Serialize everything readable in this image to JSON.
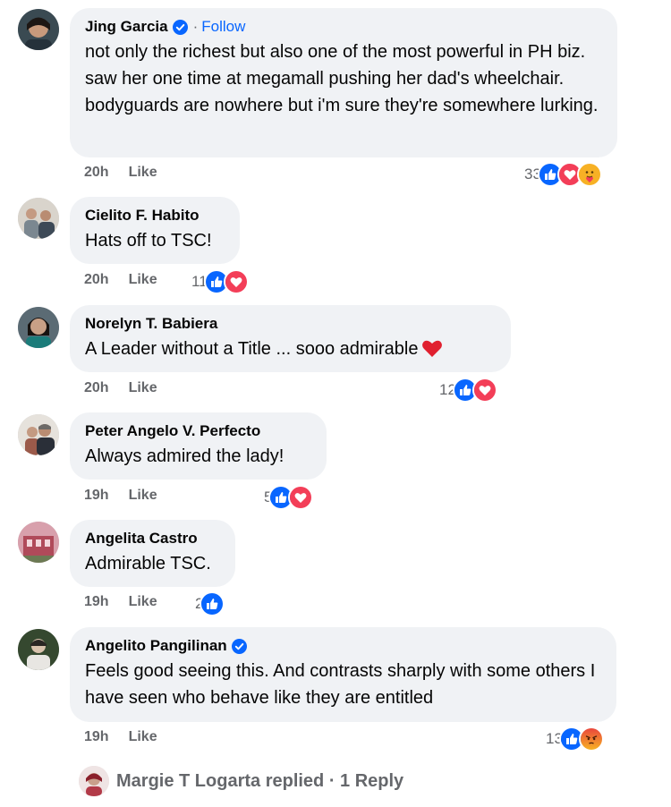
{
  "comments": [
    {
      "name": "Jing Garcia",
      "verified": true,
      "follow": "Follow",
      "text": "not only the richest but also one of the most powerful in PH biz. saw her one time at megamall pushing her dad's wheelchair. bodyguards are nowhere but i'm sure they're somewhere lurking.",
      "time": "20h",
      "like": "Like",
      "reaction_count": "33",
      "reactions": [
        "like",
        "love",
        "care"
      ]
    },
    {
      "name": "Cielito F. Habito",
      "text": "Hats off to TSC!",
      "time": "20h",
      "like": "Like",
      "reaction_count": "11",
      "reactions": [
        "like",
        "love"
      ]
    },
    {
      "name": "Norelyn T. Babiera",
      "text": "A Leader without a Title ... sooo admirable",
      "time": "20h",
      "like": "Like",
      "reaction_count": "12",
      "reactions": [
        "like",
        "love"
      ]
    },
    {
      "name": "Peter Angelo V. Perfecto",
      "text": "Always admired the lady!",
      "time": "19h",
      "like": "Like",
      "reaction_count": "5",
      "reactions": [
        "like",
        "love"
      ]
    },
    {
      "name": "Angelita Castro",
      "text": "Admirable TSC.",
      "time": "19h",
      "like": "Like",
      "reaction_count": "2",
      "reactions": [
        "like"
      ]
    },
    {
      "name": "Angelito Pangilinan",
      "verified": true,
      "text": "Feels good seeing this. And contrasts sharply with some others I have seen who behave like they are entitled",
      "time": "19h",
      "like": "Like",
      "reaction_count": "13",
      "reactions": [
        "like",
        "angry"
      ]
    }
  ],
  "reply": {
    "text": "Margie T Logarta replied · 1 Reply"
  },
  "colors": {
    "like_blue": "#0866ff",
    "love_red": "#f33e58",
    "angry_orange": "#f7714c",
    "bubble_bg": "#f0f2f5",
    "meta_gray": "#65676b"
  }
}
